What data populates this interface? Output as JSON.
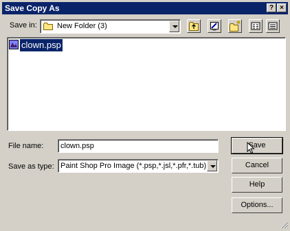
{
  "window": {
    "title": "Save Copy As",
    "help_glyph": "?",
    "close_glyph": "×"
  },
  "toolbar": {
    "save_in_label": "Save in:",
    "save_in_value": "New Folder (3)"
  },
  "files": [
    {
      "name": "clown.psp",
      "selected": true
    }
  ],
  "form": {
    "filename_label": "File name:",
    "filename_value": "clown.psp",
    "type_label": "Save as type:",
    "type_value": "Paint Shop Pro Image (*.psp,*.jsl,*.pfr,*.tub)"
  },
  "buttons": {
    "save": "Save",
    "cancel": "Cancel",
    "help": "Help",
    "options": "Options..."
  },
  "colors": {
    "titlebar": "#0a246a",
    "face": "#d4d0c8",
    "selection": "#0a246a"
  }
}
